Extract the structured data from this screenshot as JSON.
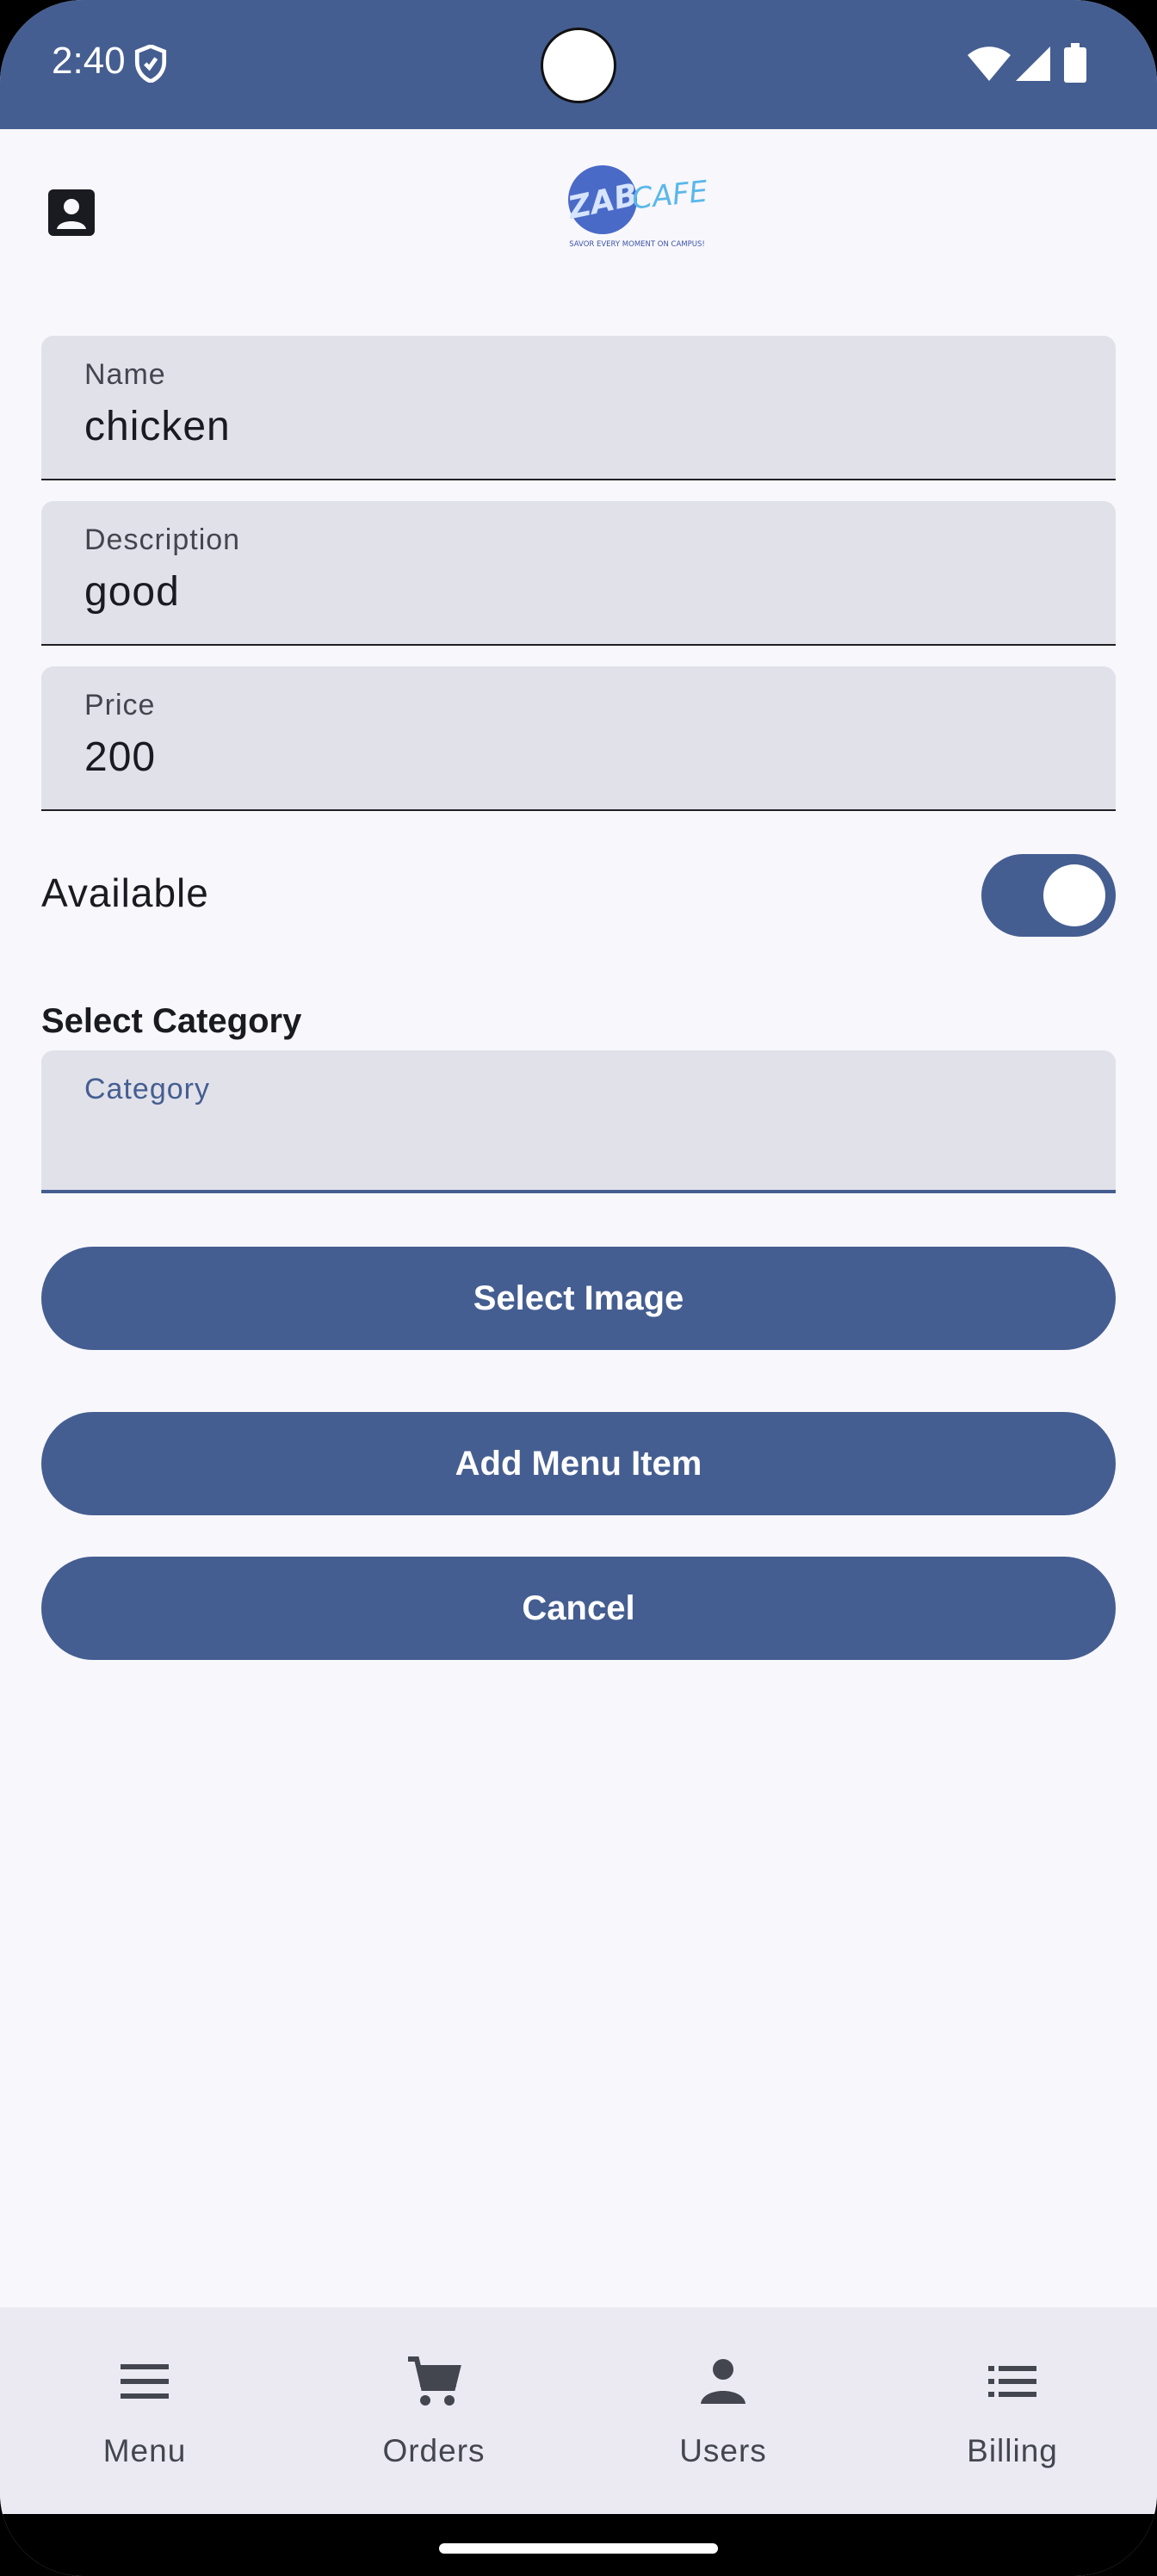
{
  "status_bar": {
    "time": "2:40",
    "icons": [
      "shield-icon",
      "wifi-icon",
      "signal-icon",
      "battery-icon"
    ]
  },
  "app_bar": {
    "profile_icon": "contact-icon",
    "logo_text": "ZAB CAFE",
    "logo_tagline": "SAVOR EVERY MOMENT ON CAMPUS!"
  },
  "form": {
    "name": {
      "label": "Name",
      "value": "chicken"
    },
    "description": {
      "label": "Description",
      "value": "good"
    },
    "price": {
      "label": "Price",
      "value": "200"
    },
    "available": {
      "label": "Available",
      "checked": true
    },
    "category_section_title": "Select Category",
    "category": {
      "label": "Category",
      "value": ""
    }
  },
  "buttons": {
    "select_image": "Select Image",
    "add_menu_item": "Add Menu Item",
    "cancel": "Cancel"
  },
  "bottom_nav": [
    {
      "label": "Menu",
      "icon": "menu-icon"
    },
    {
      "label": "Orders",
      "icon": "cart-icon"
    },
    {
      "label": "Users",
      "icon": "person-icon"
    },
    {
      "label": "Billing",
      "icon": "list-icon"
    }
  ],
  "colors": {
    "primary": "#455e91",
    "background": "#f8f7fc",
    "field_background": "#e1e1ea",
    "nav_background": "#ebeaf3"
  }
}
